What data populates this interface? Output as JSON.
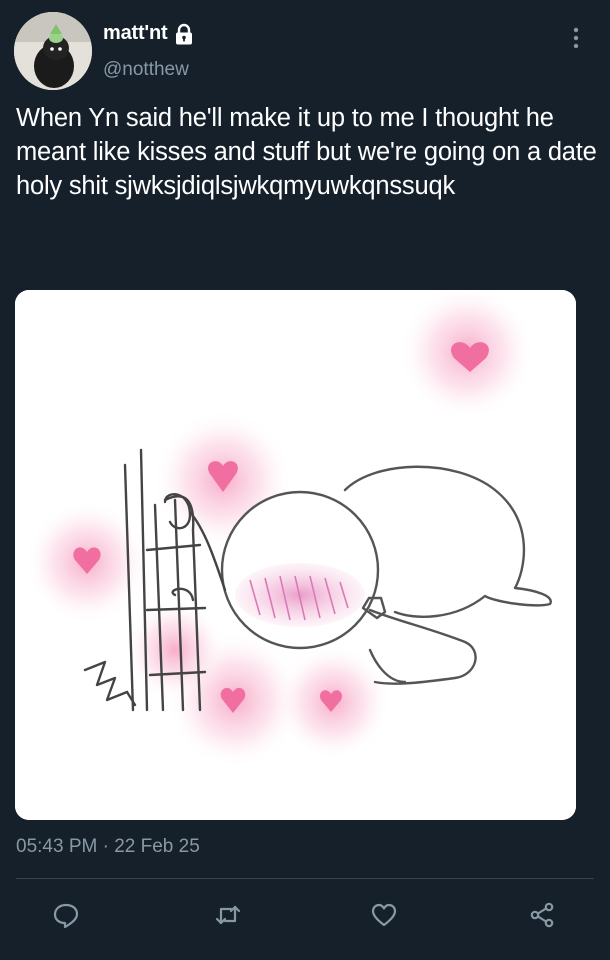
{
  "user": {
    "display_name": "matt'nt",
    "handle": "@notthew",
    "protected": true
  },
  "tweet": {
    "text": "When Yn said he'll make it up to me I thought he meant like kisses and stuff but we're going on a date holy shit sjwksjdiqlsjwkqmyuwkqnssuqk",
    "timestamp": "05:43 PM",
    "separator": "·",
    "date": "22 Feb 25"
  },
  "icons": {
    "verified_lock": "lock-icon",
    "menu": "more-vertical-icon",
    "reply": "reply-icon",
    "retweet": "retweet-icon",
    "like": "heart-icon",
    "share": "share-icon"
  },
  "colors": {
    "background": "#15202b",
    "text": "#ffffff",
    "secondary_text": "#8899a6",
    "divider": "#38444d",
    "heart_pink": "#f48fb1"
  }
}
